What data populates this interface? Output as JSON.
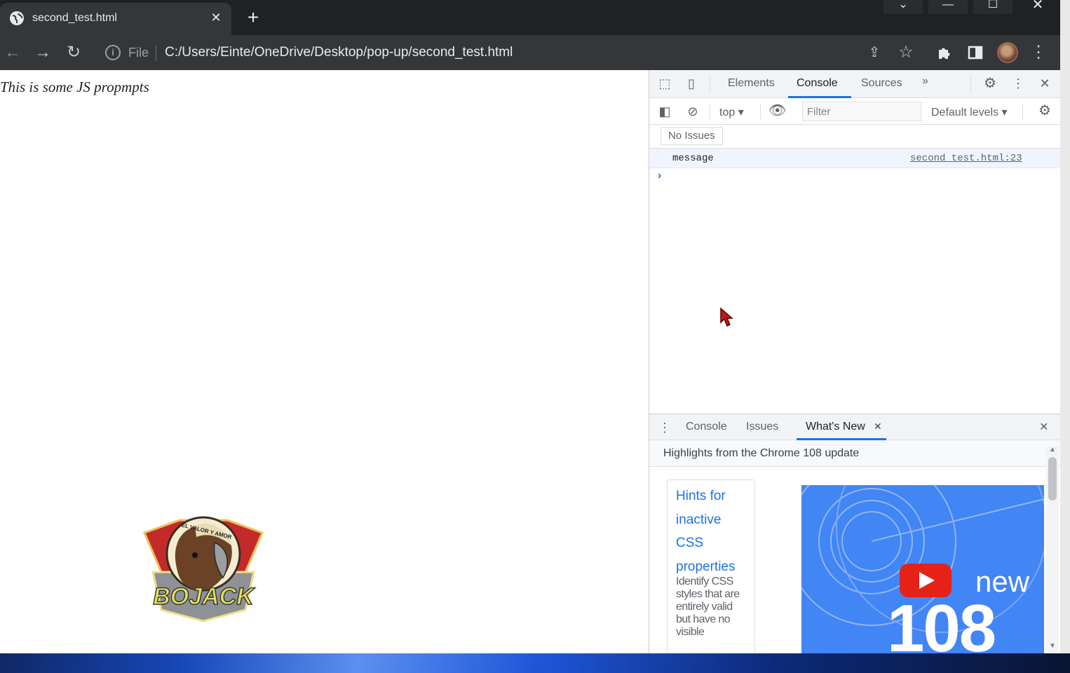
{
  "browser": {
    "tab_title": "second_test.html",
    "tab_close": "✕",
    "new_tab": "+",
    "window_controls": {
      "tabsearch": "⌄",
      "minimize": "—",
      "maximize": "☐",
      "close": "✕"
    },
    "scheme_label": "File",
    "url": "C:/Users/Einte/OneDrive/Desktop/pop-up/second_test.html"
  },
  "page": {
    "text": "This is some JS propmpts",
    "logo_text": "BOJACK",
    "logo_motto": "EL VALOR Y AMOR"
  },
  "devtools": {
    "tabs": [
      "Elements",
      "Console",
      "Sources"
    ],
    "more_tabs": "»",
    "context": "top",
    "filter_placeholder": "Filter",
    "levels": "Default levels",
    "issues_button": "No Issues",
    "log": {
      "message": "message",
      "source": "second_test.html:23"
    },
    "prompt": "›",
    "drawer_tabs": [
      "Console",
      "Issues",
      "What's New"
    ],
    "drawer_tab_close": "✕",
    "drawer_close": "✕",
    "whatsnew_header": "Highlights from the Chrome 108 update",
    "card_title": "Hints for inactive CSS properties",
    "card_desc": "Identify CSS styles that are entirely valid but have no visible",
    "banner_new": "new",
    "banner_version": "108"
  },
  "colors": {
    "accent": "#1a73e8",
    "chrome_dark": "#202124",
    "toolbar": "#35363a"
  }
}
